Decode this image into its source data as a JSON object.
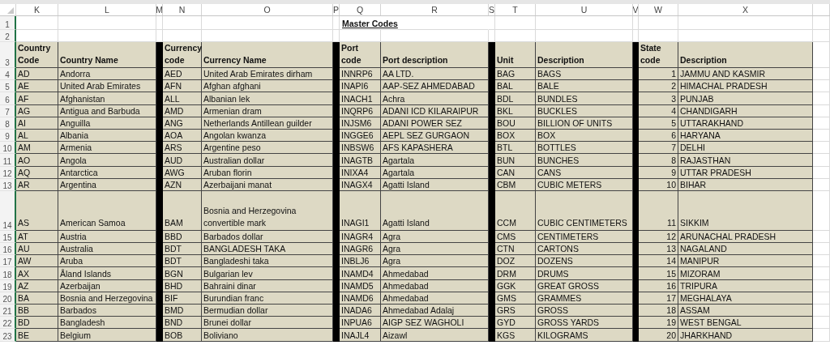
{
  "columns": [
    {
      "letter": "K",
      "kind": "text"
    },
    {
      "letter": "L",
      "kind": "text"
    },
    {
      "letter": "M",
      "kind": "separator"
    },
    {
      "letter": "N",
      "kind": "text"
    },
    {
      "letter": "O",
      "kind": "text"
    },
    {
      "letter": "P",
      "kind": "separator"
    },
    {
      "letter": "Q",
      "kind": "text"
    },
    {
      "letter": "R",
      "kind": "text"
    },
    {
      "letter": "S",
      "kind": "separator"
    },
    {
      "letter": "T",
      "kind": "text"
    },
    {
      "letter": "U",
      "kind": "text"
    },
    {
      "letter": "V",
      "kind": "separator"
    },
    {
      "letter": "W",
      "kind": "number"
    },
    {
      "letter": "X",
      "kind": "text"
    }
  ],
  "rows": [
    {
      "number": "1",
      "kind": "title",
      "title": "Master Codes"
    },
    {
      "number": "2",
      "kind": "blank"
    },
    {
      "number": "3",
      "kind": "header",
      "cells": [
        "Country Code",
        "Country Name",
        "Currency code",
        "Currency Name",
        "Port code",
        "Port description",
        "Unit",
        "Description",
        "State code",
        "Description"
      ]
    },
    {
      "number": "4",
      "kind": "data",
      "cells": [
        "AD",
        "Andorra",
        "AED",
        "United Arab Emirates dirham",
        "INNRP6",
        "AA LTD.",
        "BAG",
        "BAGS",
        "1",
        "JAMMU AND KASMIR"
      ]
    },
    {
      "number": "5",
      "kind": "data",
      "cells": [
        "AE",
        "United Arab Emirates",
        "AFN",
        "Afghan afghani",
        "INAPI6",
        "AAP-SEZ AHMEDABAD",
        "BAL",
        "BALE",
        "2",
        "HIMACHAL PRADESH"
      ]
    },
    {
      "number": "6",
      "kind": "data",
      "cells": [
        "AF",
        "Afghanistan",
        "ALL",
        "Albanian lek",
        "INACH1",
        "Achra",
        "BDL",
        "BUNDLES",
        "3",
        "PUNJAB"
      ]
    },
    {
      "number": "7",
      "kind": "data",
      "cells": [
        "AG",
        "Antigua and Barbuda",
        "AMD",
        "Armenian dram",
        "INQRP6",
        "ADANI ICD KILARAIPUR",
        "BKL",
        "BUCKLES",
        "4",
        "CHANDIGARH"
      ]
    },
    {
      "number": "8",
      "kind": "data",
      "cells": [
        "AI",
        "Anguilla",
        "ANG",
        "Netherlands Antillean guilder",
        "INJSM6",
        "ADANI POWER SEZ",
        "BOU",
        "BILLION OF UNITS",
        "5",
        "UTTARAKHAND"
      ]
    },
    {
      "number": "9",
      "kind": "data",
      "cells": [
        "AL",
        "Albania",
        "AOA",
        "Angolan kwanza",
        "INGGE6",
        "AEPL SEZ GURGAON",
        "BOX",
        "BOX",
        "6",
        "HARYANA"
      ]
    },
    {
      "number": "10",
      "kind": "data",
      "cells": [
        "AM",
        "Armenia",
        "ARS",
        "Argentine peso",
        "INBSW6",
        "AFS KAPASHERA",
        "BTL",
        "BOTTLES",
        "7",
        "DELHI"
      ]
    },
    {
      "number": "11",
      "kind": "data",
      "cells": [
        "AO",
        "Angola",
        "AUD",
        "Australian dollar",
        "INAGTB",
        "Agartala",
        "BUN",
        "BUNCHES",
        "8",
        "RAJASTHAN"
      ]
    },
    {
      "number": "12",
      "kind": "data",
      "cells": [
        "AQ",
        "Antarctica",
        "AWG",
        "Aruban florin",
        "INIXA4",
        "Agartala",
        "CAN",
        "CANS",
        "9",
        "UTTAR PRADESH"
      ]
    },
    {
      "number": "13",
      "kind": "data",
      "cells": [
        "AR",
        "Argentina",
        "AZN",
        "Azerbaijani manat",
        "INAGX4",
        "Agatti Island",
        "CBM",
        "CUBIC METERS",
        "10",
        "BIHAR"
      ]
    },
    {
      "number": "14",
      "kind": "tall",
      "cells": [
        "AS",
        "American Samoa",
        "BAM",
        "Bosnia and Herzegovina convertible mark",
        "INAGI1",
        "Agatti Island",
        "CCM",
        "CUBIC CENTIMETERS",
        "11",
        "SIKKIM"
      ]
    },
    {
      "number": "15",
      "kind": "data",
      "cells": [
        "AT",
        "Austria",
        "BBD",
        "Barbados dollar",
        "INAGR4",
        "Agra",
        "CMS",
        "CENTIMETERS",
        "12",
        "ARUNACHAL PRADESH"
      ]
    },
    {
      "number": "16",
      "kind": "data",
      "cells": [
        "AU",
        "Australia",
        "BDT",
        "BANGLADESH TAKA",
        "INAGR6",
        "Agra",
        "CTN",
        "CARTONS",
        "13",
        "NAGALAND"
      ]
    },
    {
      "number": "17",
      "kind": "data",
      "cells": [
        "AW",
        "Aruba",
        "BDT",
        "Bangladeshi taka",
        "INBLJ6",
        "Agra",
        "DOZ",
        "DOZENS",
        "14",
        "MANIPUR"
      ]
    },
    {
      "number": "18",
      "kind": "data",
      "cells": [
        "AX",
        "Åland Islands",
        "BGN",
        "Bulgarian lev",
        "INAMD4",
        "Ahmedabad",
        "DRM",
        "DRUMS",
        "15",
        "MIZORAM"
      ]
    },
    {
      "number": "19",
      "kind": "data",
      "cells": [
        "AZ",
        "Azerbaijan",
        "BHD",
        "Bahraini dinar",
        "INAMD5",
        "Ahmedabad",
        "GGK",
        "GREAT GROSS",
        "16",
        "TRIPURA"
      ]
    },
    {
      "number": "20",
      "kind": "data",
      "cells": [
        "BA",
        "Bosnia and Herzegovina",
        "BIF",
        "Burundian franc",
        "INAMD6",
        "Ahmedabad",
        "GMS",
        "GRAMMES",
        "17",
        "MEGHALAYA"
      ]
    },
    {
      "number": "21",
      "kind": "data",
      "cells": [
        "BB",
        "Barbados",
        "BMD",
        "Bermudian dollar",
        "INADA6",
        "Ahmedabad Adalaj",
        "GRS",
        "GROSS",
        "18",
        "ASSAM"
      ]
    },
    {
      "number": "22",
      "kind": "data",
      "cells": [
        "BD",
        "Bangladesh",
        "BND",
        "Brunei dollar",
        "INPUA6",
        "AIGP SEZ WAGHOLI",
        "GYD",
        "GROSS YARDS",
        "19",
        "WEST BENGAL"
      ]
    },
    {
      "number": "23",
      "kind": "data",
      "cells": [
        "BE",
        "Belgium",
        "BOB",
        "Boliviano",
        "INAJL4",
        "Aizawl",
        "KGS",
        "KILOGRAMS",
        "20",
        "JHARKHAND"
      ]
    }
  ]
}
